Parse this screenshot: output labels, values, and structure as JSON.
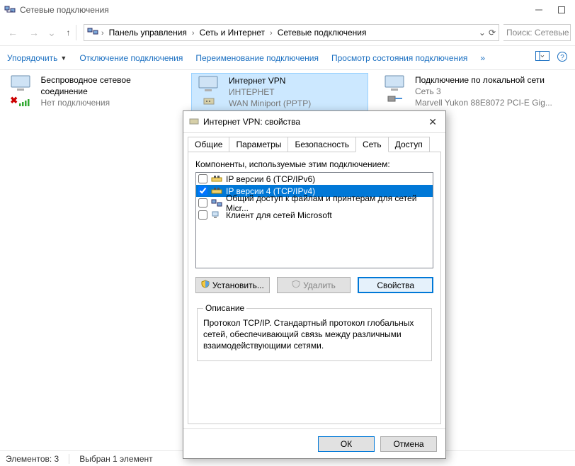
{
  "window": {
    "title": "Сетевые подключения"
  },
  "breadcrumbs": {
    "b1": "Панель управления",
    "b2": "Сеть и Интернет",
    "b3": "Сетевые подключения"
  },
  "search": {
    "placeholder": "Поиск: Сетевые п"
  },
  "toolbar": {
    "organize": "Упорядочить",
    "disable": "Отключение подключения",
    "rename": "Переименование подключения",
    "status": "Просмотр состояния подключения",
    "more": "»"
  },
  "items": [
    {
      "name": "Беспроводное сетевое соединение",
      "sub1": "Нет подключения",
      "sub2": ""
    },
    {
      "name": "Интернет  VPN",
      "sub1": "ИНТЕРНЕТ",
      "sub2": "WAN Miniport (PPTP)"
    },
    {
      "name": "Подключение по локальной сети",
      "sub1": "Сеть 3",
      "sub2": "Marvell Yukon 88E8072 PCI-E Gig..."
    }
  ],
  "statusbar": {
    "count": "Элементов: 3",
    "sel": "Выбран 1 элемент"
  },
  "dialog": {
    "title": "Интернет  VPN: свойства",
    "tabs": {
      "t1": "Общие",
      "t2": "Параметры",
      "t3": "Безопасность",
      "t4": "Сеть",
      "t5": "Доступ"
    },
    "components_label": "Компоненты, используемые этим подключением:",
    "list": [
      {
        "checked": false,
        "label": "IP версии 6 (TCP/IPv6)"
      },
      {
        "checked": true,
        "label": "IP версии 4 (TCP/IPv4)"
      },
      {
        "checked": false,
        "label": "Общий доступ к файлам и принтерам для сетей Micr..."
      },
      {
        "checked": false,
        "label": "Клиент для сетей Microsoft"
      }
    ],
    "buttons": {
      "install": "Установить...",
      "uninstall": "Удалить",
      "props": "Свойства"
    },
    "desc_legend": "Описание",
    "desc_text": "Протокол TCP/IP. Стандартный протокол глобальных сетей, обеспечивающий связь между различными взаимодействующими сетями.",
    "ok": "ОК",
    "cancel": "Отмена"
  }
}
